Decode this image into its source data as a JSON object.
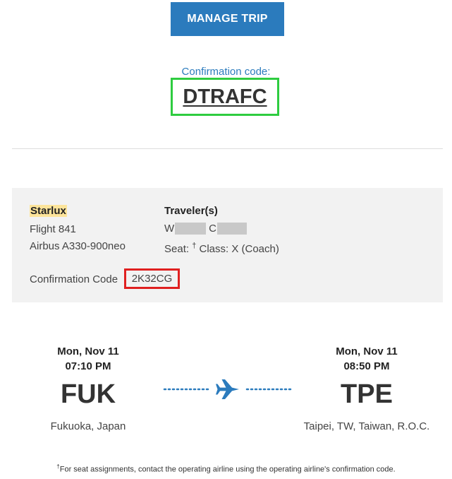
{
  "header": {
    "manage_trip_label": "MANAGE TRIP",
    "confirmation_label": "Confirmation code:",
    "confirmation_code": "DTRAFC"
  },
  "flight_info": {
    "airline": "Starlux",
    "flight": "Flight 841",
    "aircraft": "Airbus A330-900neo",
    "travelers_heading": "Traveler(s)",
    "traveler_first_initial": "W",
    "traveler_last_initial": "C",
    "seat_label": "Seat:",
    "seat_dagger": "†",
    "class_text": "Class: X (Coach)",
    "airline_conf_label": "Confirmation Code",
    "airline_conf_code": "2K32CG"
  },
  "segment": {
    "departure": {
      "date": "Mon, Nov 11",
      "time": "07:10 PM",
      "code": "FUK",
      "city": "Fukuoka, Japan"
    },
    "arrival": {
      "date": "Mon, Nov 11",
      "time": "08:50 PM",
      "code": "TPE",
      "city": "Taipei, TW, Taiwan, R.O.C."
    }
  },
  "footnote": {
    "dagger": "†",
    "text": "For seat assignments, contact the operating airline using the operating airline's confirmation code."
  },
  "colors": {
    "accent": "#2b7bbd",
    "highlight_green": "#2ecc40",
    "highlight_red": "#e02020",
    "airline_highlight": "#fde49a",
    "panel_bg": "#f2f2f2"
  }
}
